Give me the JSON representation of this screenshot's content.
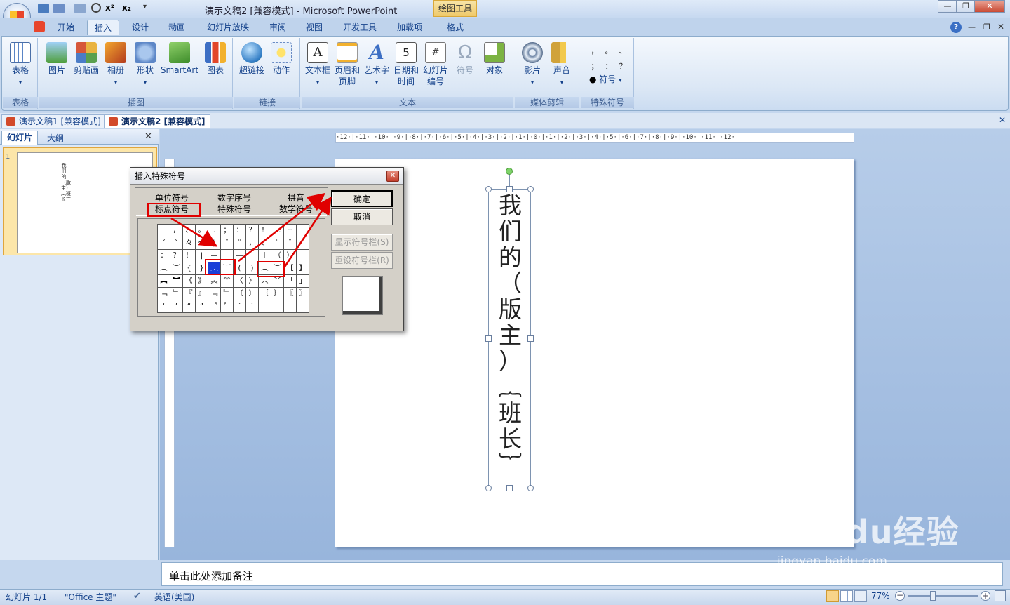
{
  "window": {
    "title": "演示文稿2 [兼容模式] - Microsoft PowerPoint",
    "context_tab": "绘图工具",
    "minimize": "—",
    "restore": "❐",
    "close": "✕"
  },
  "qat": {
    "superscript": "x²",
    "subscript": "x₂"
  },
  "ribbon_tabs": [
    "开始",
    "插入",
    "设计",
    "动画",
    "幻灯片放映",
    "审阅",
    "视图",
    "开发工具",
    "加载项",
    "格式"
  ],
  "active_tab": "插入",
  "help": "?",
  "groups": {
    "table": {
      "label": "表格",
      "buttons": [
        "表格"
      ]
    },
    "illustrations": {
      "label": "插图",
      "buttons": [
        "图片",
        "剪贴画",
        "相册",
        "形状",
        "SmartArt",
        "图表"
      ]
    },
    "links": {
      "label": "链接",
      "buttons": [
        "超链接",
        "动作"
      ]
    },
    "text": {
      "label": "文本",
      "buttons": [
        "文本框",
        "页眉和\n页脚",
        "艺术字",
        "日期和\n时间",
        "幻灯片\n编号",
        "符号",
        "对象"
      ]
    },
    "media": {
      "label": "媒体剪辑",
      "buttons": [
        "影片",
        "声音"
      ]
    },
    "special": {
      "label": "特殊符号",
      "button": "符号",
      "symbols": [
        "，",
        "。",
        "、",
        "；",
        "：",
        "？"
      ]
    }
  },
  "doc_tabs": [
    "演示文稿1 [兼容模式]",
    "演示文稿2 [兼容模式]"
  ],
  "panel_tabs": [
    "幻灯片",
    "大纲"
  ],
  "slide_number": "1",
  "thumb_text": "我们的（版主）︷班长︸",
  "ruler": "·12·|·11·|·10·|·9·|·8·|·7·|·6·|·5·|·4·|·3·|·2·|·1·|·0·|·1·|·2·|·3·|·4·|·5·|·6·|·7·|·8·|·9·|·10·|·11·|·12·",
  "slide_text": [
    "我",
    "们",
    "的",
    "（",
    "版",
    "主",
    "）",
    "︷",
    "班",
    "长",
    "︸"
  ],
  "notes_placeholder": "单击此处添加备注",
  "status": {
    "slide": "幻灯片 1/1",
    "theme": "\"Office 主题\"",
    "language": "英语(美国)",
    "zoom": "77%"
  },
  "dialog": {
    "title": "插入特殊符号",
    "tabs_row1": [
      "单位符号",
      "数字序号",
      "拼音"
    ],
    "tabs_row2": [
      "标点符号",
      "特殊符号",
      "数学符号"
    ],
    "ok": "确定",
    "cancel": "取消",
    "show_bar": "显示符号栏(S)",
    "reset_bar": "重设符号栏(R)",
    "grid": [
      [
        "",
        "，",
        "、",
        "。",
        ".",
        "；",
        "：",
        "？",
        "！",
        "…",
        "··"
      ],
      [
        "ˊ",
        "ˋ",
        "々",
        "～",
        "‖",
        "ˇ",
        "¨",
        "，",
        "、",
        "¨",
        "ˉ"
      ],
      [
        "：",
        "？",
        "！",
        "|",
        "—",
        "|",
        "—",
        "|",
        "︱",
        "（",
        "）"
      ],
      [
        "︵",
        "︶",
        "{",
        "}",
        "︷",
        "︸",
        "(",
        ")",
        "︵",
        "︶",
        "【",
        "】"
      ],
      [
        "︻",
        "︼",
        "《",
        "》",
        "︽",
        "︾",
        "〈",
        "〉",
        "︿",
        "﹀",
        "「",
        "」"
      ],
      [
        "﹁",
        "﹂",
        "『",
        "』",
        "﹃",
        "﹄",
        "〔",
        "〕",
        "｛",
        "｝",
        "〖",
        "〗"
      ],
      [
        "‘",
        "’",
        "“",
        "”",
        "〝",
        "〞",
        "ˊ",
        "ˋ",
        "",
        "",
        "",
        ""
      ]
    ]
  },
  "watermark": {
    "brand": "Bai du经验",
    "url": "jingyan.baidu.com"
  }
}
